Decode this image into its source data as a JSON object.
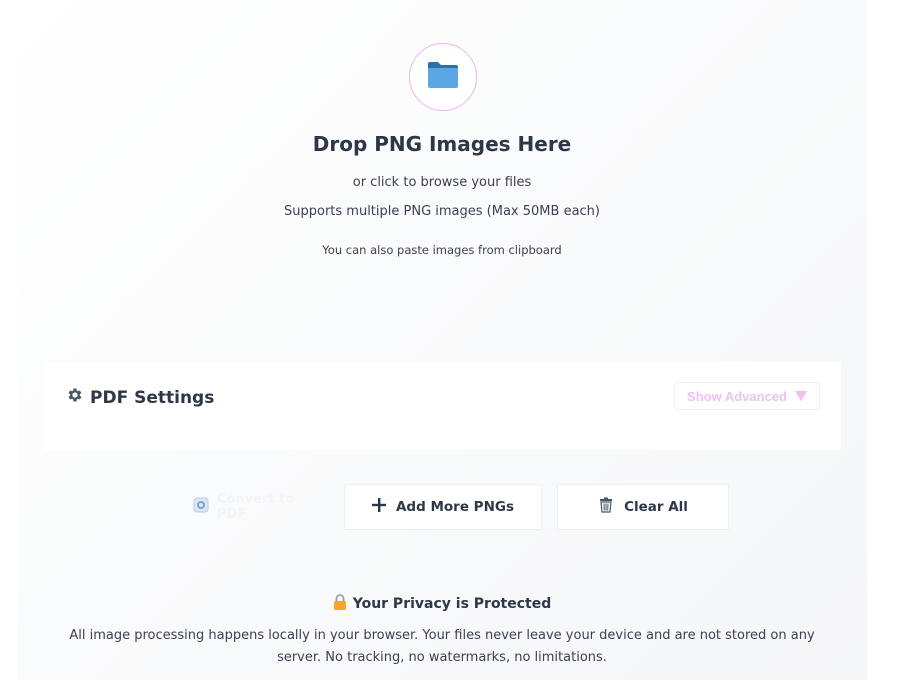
{
  "drop_zone": {
    "icon": "folder-icon",
    "title": "Drop PNG Images Here",
    "subtitle": "or click to browse your files",
    "support_text": "Supports multiple PNG images (Max 50MB each)",
    "paste_hint": "You can also paste images from clipboard"
  },
  "settings": {
    "icon": "gear-icon",
    "title": "PDF Settings",
    "toggle_label": "Show Advanced",
    "toggle_icon": "caret-down-icon"
  },
  "actions": {
    "convert_label": "Convert to PDF",
    "add_label": "Add More PNGs",
    "add_icon": "plus-icon",
    "clear_label": "Clear All",
    "clear_icon": "trash-icon"
  },
  "privacy": {
    "icon": "lock-icon",
    "title": "Your Privacy is Protected",
    "text": "All image processing happens locally in your browser. Your files never leave your device and are not stored on any server. No tracking, no watermarks, no limitations."
  },
  "colors": {
    "accent_pink": "#e9b6f0",
    "folder_blue": "#4a9bdc",
    "text_dark": "#2d3748"
  }
}
